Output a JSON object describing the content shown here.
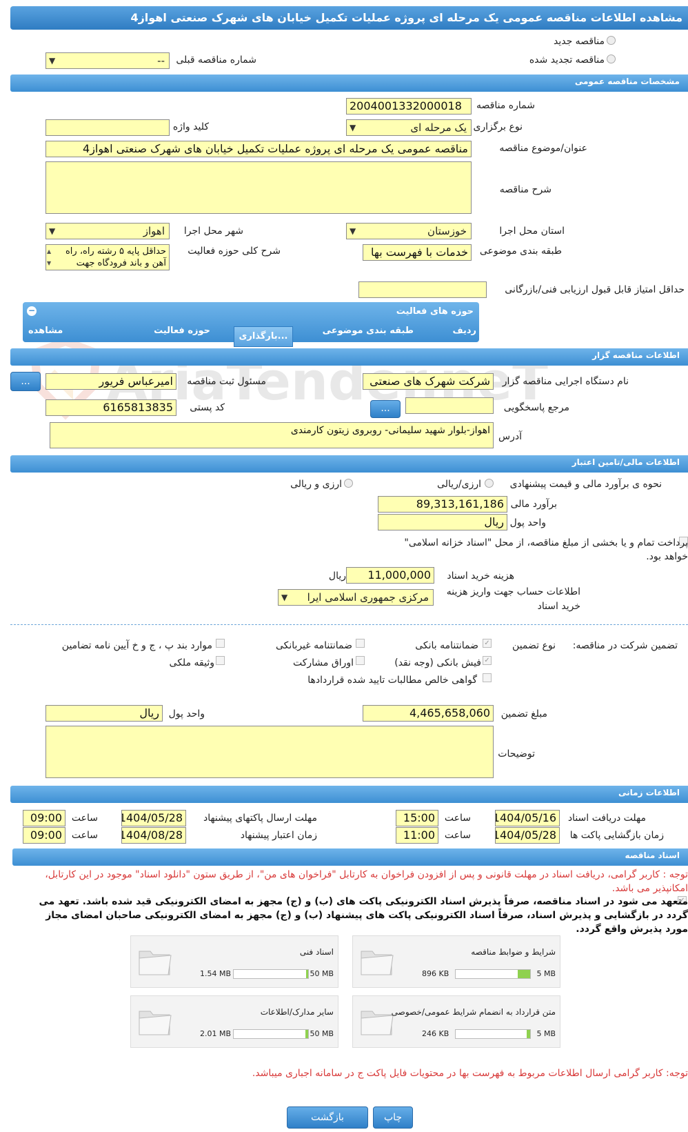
{
  "title": "مشاهده اطلاعات مناقصه عمومی یک مرحله ای پروژه عملیات تکمیل خیابان های شهرک صنعتی اهواز4",
  "top": {
    "radio_new": "مناقصه جدید",
    "radio_renewed": "مناقصه تجدید شده",
    "prev_number_label": "شماره مناقصه قبلی",
    "prev_number_value": "--"
  },
  "general": {
    "header": "مشخصات مناقصه عمومی",
    "number_label": "شماره مناقصه",
    "number_value": "2004001332000018",
    "type_label": "نوع برگزاری",
    "type_value": "یک مرحله ای",
    "keyword_label": "کلید واژه",
    "subject_label": "عنوان/موضوع مناقصه",
    "subject_value": "مناقصه عمومی یک مرحله ای پروژه عملیات تکمیل خیابان های شهرک صنعتی اهواز4",
    "desc_label": "شرح مناقصه",
    "province_label": "استان محل اجرا",
    "province_value": "خوزستان",
    "city_label": "شهر محل اجرا",
    "city_value": "اهواز",
    "category_label": "طبقه بندی موضوعی",
    "category_value": "خدمات با فهرست بها",
    "activity_desc_label": "شرح کلی حوزه فعالیت",
    "activity_desc_value": "حداقل پایه ۵ رشته راه، راه آهن و باند فرودگاه جهت",
    "min_score_label": "حداقل امتیاز قابل قبول ارزیابی فنی/بازرگانی"
  },
  "activity": {
    "header": "حوزه های فعالیت",
    "col_row": "ردیف",
    "col_category": "طبقه بندی موضوعی",
    "col_area": "حوزه فعالیت",
    "col_view": "مشاهده",
    "loading": "بارگذاری..."
  },
  "organizer": {
    "header": "اطلاعات مناقصه گزار",
    "org_label": "نام دستگاه اجرایی مناقصه گزار",
    "org_value": "شرکت شهرک های صنعتی",
    "responsible_label": "مسئول ثبت مناقصه",
    "responsible_value": "امیرعباس فریور",
    "ref_label": "مرجع پاسخگویی",
    "postal_label": "کد پستی",
    "postal_value": "6165813835",
    "address_label": "آدرس",
    "address_value": "اهواز-بلوار شهید سلیمانی- روبروی زیتون کارمندی",
    "dots": "..."
  },
  "finance": {
    "header": "اطلاعات مالی/تامین اعتبار",
    "method_label": "نحوه ی برآورد مالی و قیمت پیشنهادی",
    "opt_rial": "ارزی/ریالی",
    "opt_both": "ارزی و ریالی",
    "estimate_label": "برآورد مالی",
    "estimate_value": "89,313,161,186",
    "currency_label": "واحد پول",
    "currency_value": "ریال",
    "treasury_text": "پرداخت تمام و یا بخشی از مبلغ مناقصه، از محل \"اسناد خزانه اسلامی\" خواهد بود.",
    "doc_fee_label": "هزینه خرید اسناد",
    "doc_fee_value": "11,000,000",
    "doc_fee_unit": "ریال",
    "account_label": "اطلاعات حساب جهت واریز هزینه خرید اسناد",
    "account_value": "مرکزی جمهوری اسلامی ایرا"
  },
  "guarantee": {
    "title": "تضمین شرکت در مناقصه:",
    "type_label": "نوع تضمین",
    "opt_bank_guarantee": "ضمانتنامه بانکی",
    "opt_non_bank": "ضمانتنامه غیربانکی",
    "opt_items": "موارد بند پ ، ج و خ آیین نامه تضامین",
    "opt_cash": "فیش بانکی (وجه نقد)",
    "opt_bonds": "اوراق مشارکت",
    "opt_property": "وثیقه ملکی",
    "opt_claims": "گواهی خالص مطالبات تایید شده قراردادها",
    "amount_label": "مبلغ تضمین",
    "amount_value": "4,465,658,060",
    "currency_label": "واحد پول",
    "currency_value": "ریال",
    "notes_label": "توضیحات"
  },
  "timing": {
    "header": "اطلاعات زمانی",
    "receive_label": "مهلت دریافت اسناد",
    "receive_date": "1404/05/16",
    "receive_time": "15:00",
    "send_label": "مهلت ارسال پاکتهای پیشنهاد",
    "send_date": "1404/05/28",
    "send_time": "09:00",
    "open_label": "زمان بازگشایی پاکت ها",
    "open_date": "1404/05/28",
    "open_time": "11:00",
    "valid_label": "زمان اعتبار پیشنهاد",
    "valid_date": "1404/08/28",
    "valid_time": "09:00",
    "time_label": "ساعت"
  },
  "documents": {
    "header": "اسناد مناقصه",
    "note": "توجه : کاربر گرامی، دریافت اسناد در مهلت قانونی و پس از افزودن فراخوان به کارتابل \"فراخوان های من\"، از طریق ستون \"دانلود اسناد\" موجود در این کارتابل، امکانپذیر می باشد.",
    "commit": "متعهد می شود در اسناد مناقصه، صرفاً پذیرش اسناد الکترونیکی پاکت های (ب) و (ج) مجهز به امضای الکترونیکی قید شده باشد. تعهد می گردد در بازگشایی و پذیرش اسناد، صرفاً اسناد الکترونیکی پاکت های پیشنهاد (ب) و (ج) مجهز به امضای الکترونیکی صاحبان امضای مجاز مورد پذیرش واقع گردد.",
    "cards": [
      {
        "title": "شرایط و ضوابط مناقصه",
        "max": "5 MB",
        "size": "896 KB",
        "fill": 0.17
      },
      {
        "title": "اسناد فنی",
        "max": "50 MB",
        "size": "1.54 MB",
        "fill": 0.03
      },
      {
        "title": "متن قرارداد به انضمام شرایط عمومی/خصوصی",
        "max": "5 MB",
        "size": "246 KB",
        "fill": 0.05
      },
      {
        "title": "سایر مدارک/اطلاعات",
        "max": "50 MB",
        "size": "2.01 MB",
        "fill": 0.04
      }
    ],
    "footer_note": "توجه: کاربر گرامی ارسال اطلاعات مربوط به فهرست بها در محتویات فایل پاکت ج در سامانه اجباری میباشد."
  },
  "buttons": {
    "back": "بازگشت",
    "print": "چاپ"
  },
  "watermark": "AriaTender.neT"
}
